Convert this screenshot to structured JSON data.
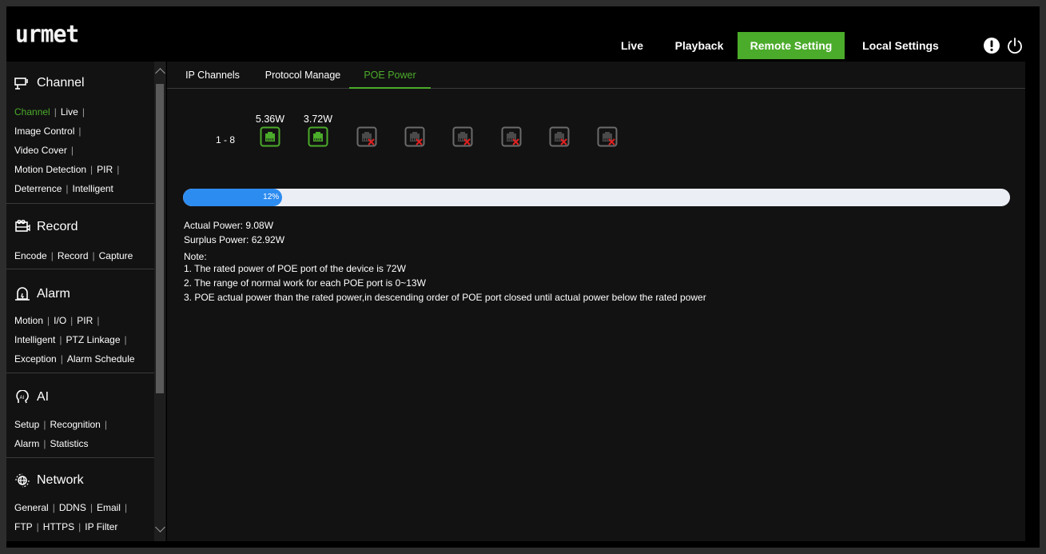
{
  "app": {
    "logo": "urmet"
  },
  "nav": {
    "items": [
      {
        "label": "Live"
      },
      {
        "label": "Playback"
      },
      {
        "label": "Remote Setting",
        "active": true
      },
      {
        "label": "Local Settings"
      }
    ],
    "icons": [
      "alert-icon",
      "power-icon"
    ]
  },
  "sidebar": {
    "sections": [
      {
        "title": "Channel",
        "icon": "channel-icon",
        "lines": [
          [
            "Channel",
            "Live"
          ],
          [
            "Image Control"
          ],
          [
            "Video Cover"
          ],
          [
            "Motion Detection",
            "PIR"
          ],
          [
            "Deterrence",
            "Intelligent"
          ]
        ],
        "active_link": "Channel"
      },
      {
        "title": "Record",
        "icon": "record-icon",
        "lines": [
          [
            "Encode",
            "Record",
            "Capture"
          ]
        ]
      },
      {
        "title": "Alarm",
        "icon": "alarm-icon",
        "lines": [
          [
            "Motion",
            "I/O",
            "PIR"
          ],
          [
            "Intelligent",
            "PTZ Linkage"
          ],
          [
            "Exception",
            "Alarm Schedule"
          ]
        ]
      },
      {
        "title": "AI",
        "icon": "ai-icon",
        "lines": [
          [
            "Setup",
            "Recognition"
          ],
          [
            "Alarm",
            "Statistics"
          ]
        ]
      },
      {
        "title": "Network",
        "icon": "network-icon",
        "lines": [
          [
            "General",
            "DDNS",
            "Email"
          ],
          [
            "FTP",
            "HTTPS",
            "IP Filter"
          ]
        ]
      }
    ]
  },
  "tabs": [
    {
      "label": "IP Channels"
    },
    {
      "label": "Protocol Manage"
    },
    {
      "label": "POE Power",
      "active": true
    }
  ],
  "poe": {
    "range_label": "1 - 8",
    "ports": [
      {
        "watt": "5.36W",
        "status": "active"
      },
      {
        "watt": "3.72W",
        "status": "active"
      },
      {
        "watt": "",
        "status": "inactive"
      },
      {
        "watt": "",
        "status": "inactive"
      },
      {
        "watt": "",
        "status": "inactive"
      },
      {
        "watt": "",
        "status": "inactive"
      },
      {
        "watt": "",
        "status": "inactive"
      },
      {
        "watt": "",
        "status": "inactive"
      }
    ],
    "usage_percent": 12,
    "usage_text": "12%",
    "actual_power": "Actual Power: 9.08W",
    "surplus_power": "Surplus Power: 62.92W",
    "note_title": "Note:",
    "notes": [
      "1. The rated power of POE port of the device is 72W",
      "2. The range of normal work for each POE port is 0~13W",
      "3. POE actual power than the rated power,in descending order of POE port closed until actual power below the rated power"
    ]
  },
  "colors": {
    "accent": "#4bab2a",
    "progress": "#2d8cf0",
    "inactive_x": "#e02020"
  }
}
